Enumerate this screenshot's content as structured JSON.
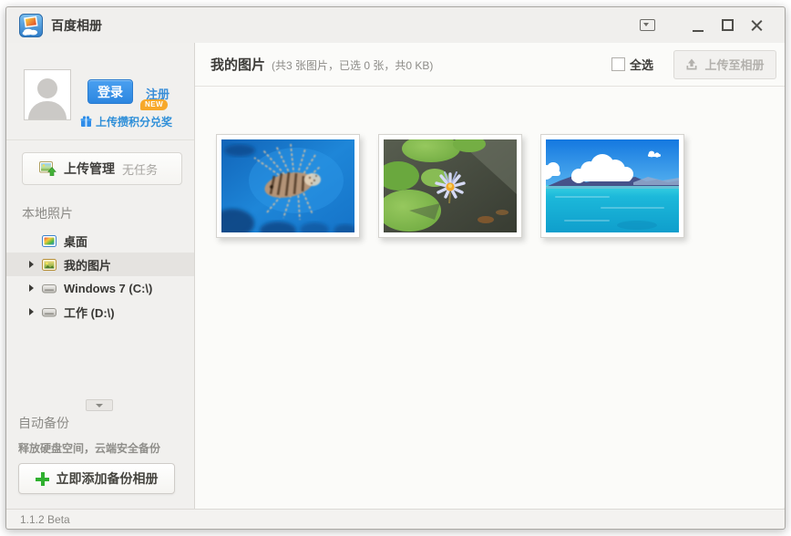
{
  "titlebar": {
    "app_title": "百度相册",
    "app_icon": "baidu-album-icon"
  },
  "statusbar": {
    "version": "1.1.2 Beta"
  },
  "sidebar": {
    "login": {
      "login_button": "登录",
      "register_link": "注册",
      "points_link": "上传攒积分兑奖",
      "points_badge": "NEW",
      "gift_icon": "gift-icon"
    },
    "upload_manager": {
      "label": "上传管理",
      "status": "无任务"
    },
    "local_photos": {
      "header": "本地照片",
      "items": [
        {
          "label": "桌面",
          "icon": "desktop-icon",
          "expandable": false,
          "selected": false
        },
        {
          "label": "我的图片",
          "icon": "pictures-folder-icon",
          "expandable": true,
          "selected": true
        },
        {
          "label": "Windows 7 (C:\\)",
          "icon": "drive-icon",
          "expandable": true,
          "selected": false
        },
        {
          "label": "工作 (D:\\)",
          "icon": "drive-icon",
          "expandable": true,
          "selected": false
        }
      ]
    },
    "auto_backup": {
      "title": "自动备份",
      "subtitle": "释放硬盘空间，云端安全备份",
      "add_button": "立即添加备份相册"
    }
  },
  "main": {
    "header": {
      "title": "我的图片",
      "summary": "(共3 张图片，已选 0 张，共0 KB)",
      "select_all_label": "全选",
      "select_all_checked": false,
      "upload_button": "上传至相册",
      "upload_button_enabled": false
    },
    "photos": [
      {
        "name": "lionfish-photo"
      },
      {
        "name": "water-lily-photo"
      },
      {
        "name": "tropical-sea-photo"
      }
    ]
  },
  "colors": {
    "accent_blue": "#3390e6",
    "link_blue": "#2f8fd8",
    "badge_orange": "#f7a82a",
    "plus_green": "#2fb02f",
    "selected_row": "#e5e3e0",
    "sidebar_bg": "#f1f0ee",
    "main_bg": "#fbfbf9"
  }
}
